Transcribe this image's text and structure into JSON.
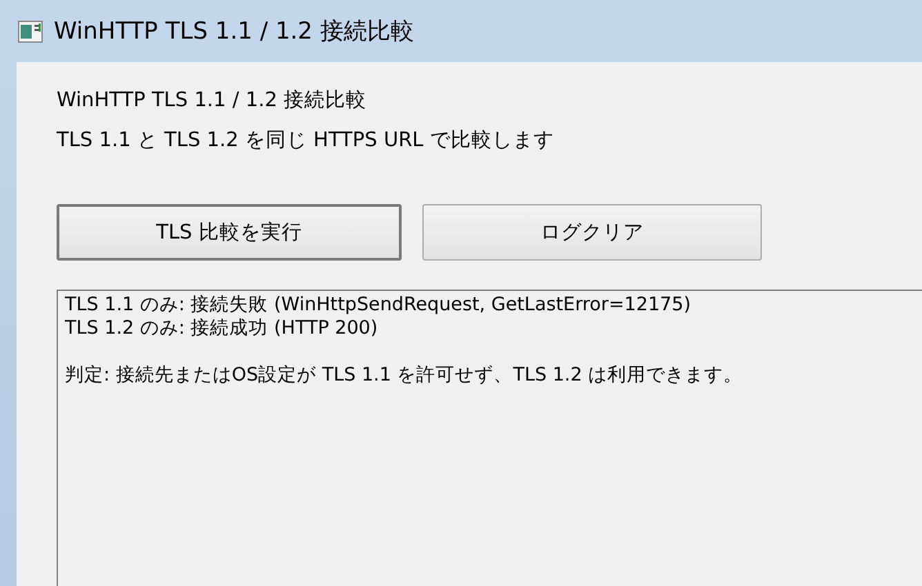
{
  "window": {
    "title": "WinHTTP TLS 1.1 / 1.2 接続比較"
  },
  "labels": [
    "WinHTTP TLS 1.1 / 1.2 接続比較",
    "TLS 1.1 と TLS 1.2 を同じ HTTPS URL で比較します"
  ],
  "buttons": [
    {
      "label": "TLS 比較を実行",
      "default": true
    },
    {
      "label": "ログクリア",
      "default": false
    }
  ],
  "log": [
    [
      "TLS 1.1 のみ: 接続失敗 (WinHttpSendRequest, GetLastError=12175)",
      "TLS 1.2 のみ: 接続成功 (HTTP 200)"
    ],
    [
      "判定: 接続先またはOS設定が TLS 1.1 を許可せず、TLS 1.2 は利用できます。"
    ]
  ]
}
